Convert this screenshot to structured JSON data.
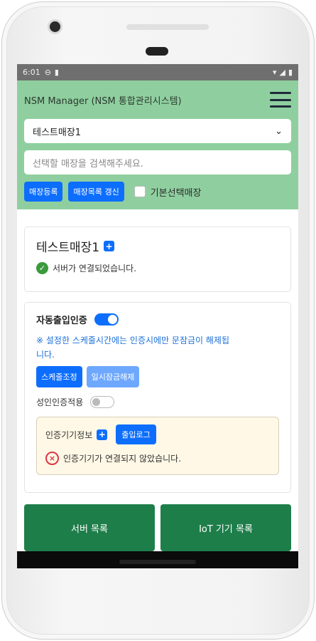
{
  "statusbar": {
    "time": "6:01"
  },
  "header": {
    "title": "NSM Manager (NSM 통합관리시스템)",
    "selected_store": "테스트매장1",
    "search_placeholder": "선택할 매장을 검색해주세요.",
    "register_button": "매장등록",
    "refresh_button": "매장목록 갱신",
    "default_label": "기본선택매장"
  },
  "store": {
    "name": "테스트매장1",
    "server_status": "서버가 연결되었습니다."
  },
  "auth": {
    "auto_label": "자동출입인증",
    "auto_enabled": true,
    "note_line1": "※ 설정한 스케줄시간에는 인증시에만 문잠금이 해제됩",
    "note_line2": "니다.",
    "schedule_button": "스케줄조정",
    "temp_unlock_button": "일시잠금해제",
    "adult_label": "성인인증적용",
    "adult_enabled": false,
    "device_label": "인증기기정보",
    "log_button": "출입로그",
    "device_status": "인증기기가 연결되지 않았습니다."
  },
  "bottom": {
    "server_list": "서버 목록",
    "iot_list": "IoT 기기 목록"
  }
}
